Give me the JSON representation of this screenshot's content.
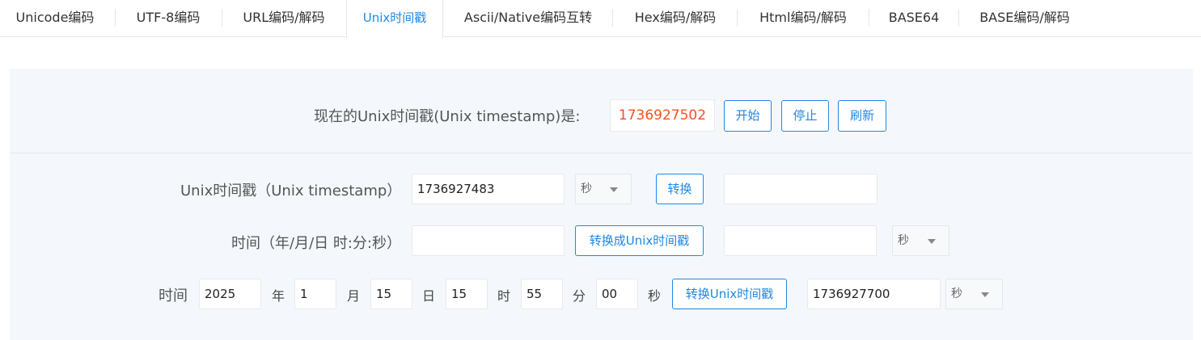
{
  "tabs": [
    {
      "label": "Unicode编码"
    },
    {
      "label": "UTF-8编码"
    },
    {
      "label": "URL编码/解码"
    },
    {
      "label": "Unix时间戳"
    },
    {
      "label": "Ascii/Native编码互转"
    },
    {
      "label": "Hex编码/解码"
    },
    {
      "label": "Html编码/解码"
    },
    {
      "label": "BASE64"
    },
    {
      "label": "BASE编码/解码"
    }
  ],
  "now": {
    "label": "现在的Unix时间戳(Unix timestamp)是:",
    "value": "1736927502",
    "start_label": "开始",
    "stop_label": "停止",
    "refresh_label": "刷新"
  },
  "row1": {
    "label": "Unix时间戳（Unix timestamp）",
    "input_value": "1736927483",
    "unit_selected": "秒",
    "convert_label": "转换",
    "result_value": ""
  },
  "row2": {
    "label": "时间（年/月/日 时:分:秒）",
    "input_value": "",
    "convert_label": "转换成Unix时间戳",
    "result_value": "",
    "unit_selected": "秒"
  },
  "row3": {
    "label": "时间",
    "year": "2025",
    "year_unit": "年",
    "month": "1",
    "month_unit": "月",
    "day": "15",
    "day_unit": "日",
    "hour": "15",
    "hour_unit": "时",
    "minute": "55",
    "minute_unit": "分",
    "second": "00",
    "second_unit": "秒",
    "convert_label": "转换Unix时间戳",
    "result_value": "1736927700",
    "unit_selected": "秒"
  },
  "colors": {
    "accent": "#1e88e5",
    "highlight": "#f4511e",
    "panel_bg": "#f4f8fc"
  }
}
